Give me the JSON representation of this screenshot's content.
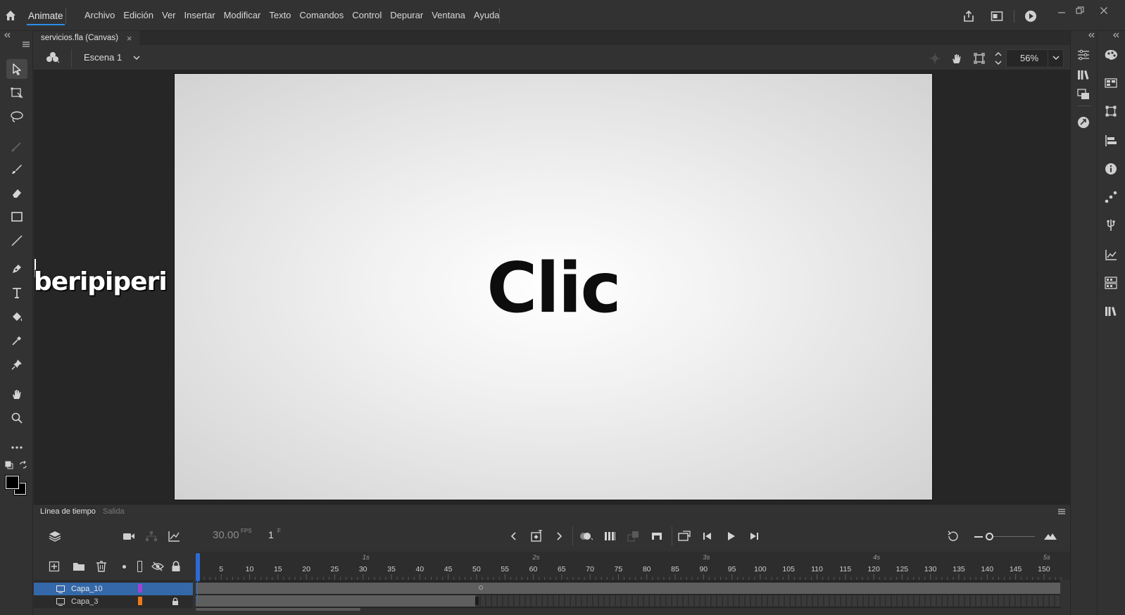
{
  "app": {
    "name": "Animate"
  },
  "menu": [
    "Archivo",
    "Edición",
    "Ver",
    "Insertar",
    "Modificar",
    "Texto",
    "Comandos",
    "Control",
    "Depurar",
    "Ventana",
    "Ayuda"
  ],
  "document": {
    "tab_title": "servicios.fla (Canvas)",
    "close_glyph": "×"
  },
  "scene": {
    "name": "Escena 1"
  },
  "zoom": {
    "value": "56%"
  },
  "stage": {
    "text": "Clic",
    "offstage_text": "beripiperi"
  },
  "timeline": {
    "tabs": [
      "Línea de tiempo",
      "Salida"
    ],
    "fps_value": "30.00",
    "fps_unit": "FPS",
    "frame_value": "1",
    "frame_unit": "F",
    "ruler_frames": [
      "5",
      "10",
      "15",
      "20",
      "25",
      "30",
      "35",
      "40",
      "45",
      "50",
      "55",
      "60",
      "65",
      "70",
      "75",
      "80",
      "85",
      "90",
      "95",
      "100",
      "105",
      "110",
      "115",
      "120",
      "125",
      "130",
      "135",
      "140",
      "145",
      "150"
    ],
    "ruler_seconds": [
      "1s",
      "2s",
      "3s",
      "4s",
      "5s"
    ],
    "layers": [
      {
        "name": "Capa_10",
        "color": "#a340d6",
        "selected": true
      },
      {
        "name": "Capa_3",
        "color": "#f07a1a",
        "locked": true
      }
    ]
  },
  "colors": {
    "accent": "#2d8ceb",
    "selected_layer": "#3468a8",
    "playhead": "#2d6ad6",
    "stroke_swatch": "#000000",
    "fill_swatch": "#000000"
  }
}
